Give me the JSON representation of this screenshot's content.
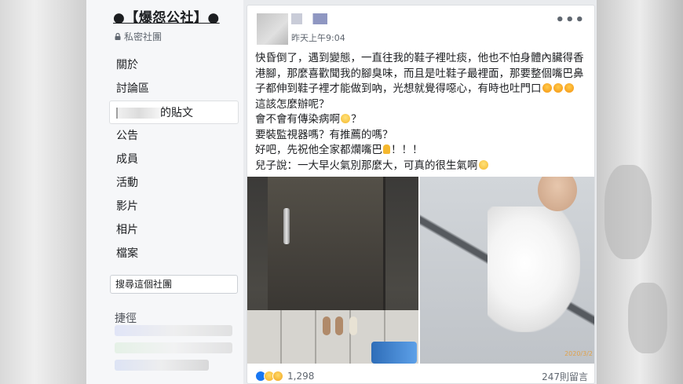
{
  "sidebar": {
    "group_title": "●【爆怨公社】●",
    "privacy": "私密社團",
    "nav_items": [
      {
        "label": "關於"
      },
      {
        "label": "討論區"
      },
      {
        "label": "的貼文",
        "active": true
      },
      {
        "label": "公告"
      },
      {
        "label": "成員"
      },
      {
        "label": "活動"
      },
      {
        "label": "影片"
      },
      {
        "label": "相片"
      },
      {
        "label": "檔案"
      }
    ],
    "search_placeholder": "搜尋這個社團",
    "shortcuts_title": "捷徑"
  },
  "post": {
    "timestamp": "昨天上午9:04",
    "more_label": "•••",
    "lines": {
      "p1": "快昏倒了，遇到變態，一直往我的鞋子裡吐痰，他也不怕身體內臟得香港腳，那麼喜歡聞我的腳臭味，而且是吐鞋子最裡面，那要整個嘴巴鼻子都伸到鞋子裡才能做到吶，光想就覺得噁心，有時也吐門口",
      "p2": "這該怎麼辦呢？",
      "p3a": "會不會有傳染病啊",
      "p3b": "？",
      "p4": "要裝監視器嗎？有推薦的嗎？",
      "p5a": "好吧，先祝他全家都爛嘴巴",
      "p5b": "！！！",
      "p6": "兒子說：一大早火氣別那麼大，可真的很生氣啊"
    },
    "photo_stamp": "2020/3/2",
    "reaction_count": "1,298",
    "comment_count": "247則留言"
  },
  "icons": {
    "lock": "lock-icon",
    "search": "search-icon",
    "like": "like-reaction-icon",
    "wow": "wow-reaction-icon",
    "haha": "haha-reaction-icon"
  },
  "colors": {
    "page_bg": "#e9ebee",
    "sidebar_bg": "#f6f7f9",
    "like_blue": "#1877f2"
  }
}
